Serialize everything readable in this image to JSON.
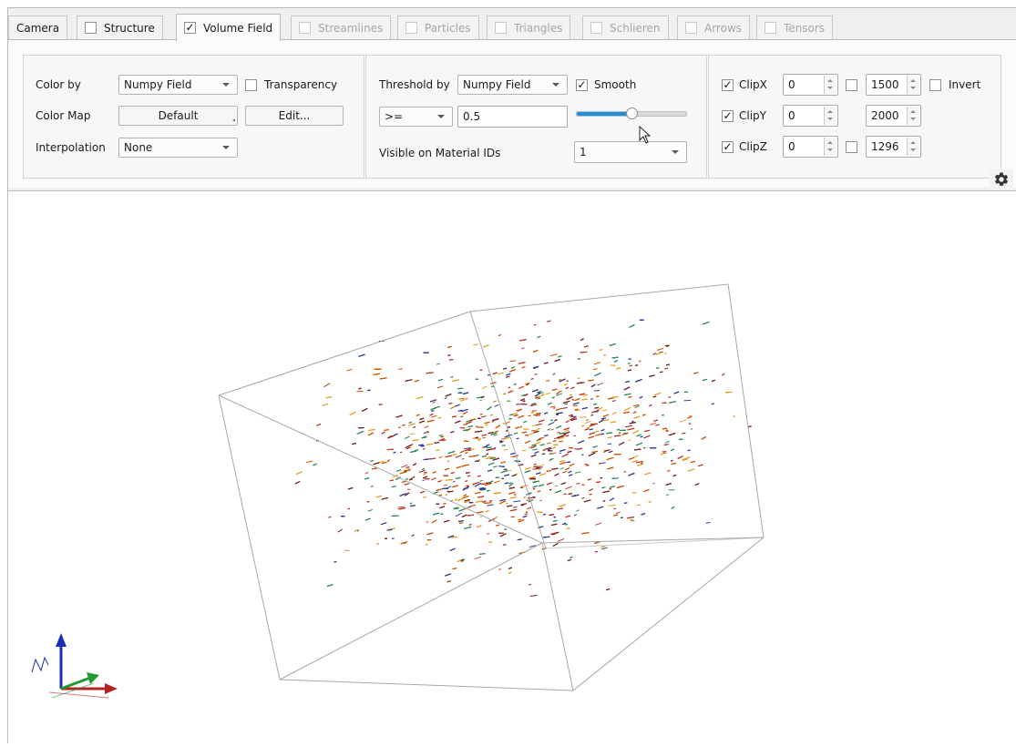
{
  "tabs": [
    {
      "label": "Camera",
      "has_checkbox": false,
      "checked": false,
      "active": false,
      "disabled": false
    },
    {
      "label": "Structure",
      "has_checkbox": true,
      "checked": false,
      "active": false,
      "disabled": false
    },
    {
      "label": "Volume Field",
      "has_checkbox": true,
      "checked": true,
      "active": true,
      "disabled": false
    },
    {
      "label": "Streamlines",
      "has_checkbox": true,
      "checked": false,
      "active": false,
      "disabled": true
    },
    {
      "label": "Particles",
      "has_checkbox": true,
      "checked": false,
      "active": false,
      "disabled": true
    },
    {
      "label": "Triangles",
      "has_checkbox": true,
      "checked": false,
      "active": false,
      "disabled": true
    },
    {
      "label": "Schlieren",
      "has_checkbox": true,
      "checked": false,
      "active": false,
      "disabled": true
    },
    {
      "label": "Arrows",
      "has_checkbox": true,
      "checked": false,
      "active": false,
      "disabled": true
    },
    {
      "label": "Tensors",
      "has_checkbox": true,
      "checked": false,
      "active": false,
      "disabled": true
    }
  ],
  "color_group": {
    "color_by_label": "Color by",
    "color_by_value": "Numpy Field",
    "transparency_label": "Transparency",
    "transparency_checked": false,
    "color_map_label": "Color Map",
    "color_map_value": "Default",
    "edit_label": "Edit...",
    "interpolation_label": "Interpolation",
    "interpolation_value": "None"
  },
  "threshold_group": {
    "threshold_by_label": "Threshold by",
    "threshold_by_value": "Numpy Field",
    "smooth_label": "Smooth",
    "smooth_checked": true,
    "operator_value": ">=",
    "threshold_value": "0.5",
    "slider_fraction": 0.5,
    "material_label": "Visible on Material IDs",
    "material_value": "1"
  },
  "clip_group": {
    "rows": [
      {
        "label": "ClipX",
        "enabled": true,
        "min": "0",
        "max_checked": false,
        "max": "1500"
      },
      {
        "label": "ClipY",
        "enabled": true,
        "min": "0",
        "max_checked": false,
        "max": "2000"
      },
      {
        "label": "ClipZ",
        "enabled": true,
        "min": "0",
        "max_checked": false,
        "max": "1296"
      }
    ],
    "invert_label": "Invert",
    "invert_checked": false
  },
  "icons": {
    "settings": "gear-icon",
    "cursor": "mouse-pointer-icon",
    "axes": "axes-triad-icon"
  },
  "colors": {
    "slider_fill": "#1e90dd",
    "point_palette": [
      "#c0392b",
      "#e5a024",
      "#7a1f1f",
      "#2c3e9e",
      "#2e8b57",
      "#d35400"
    ]
  }
}
